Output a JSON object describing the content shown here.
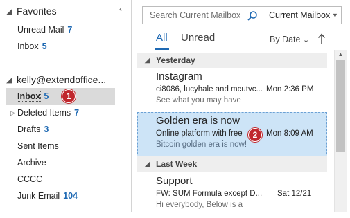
{
  "nav": {
    "favorites_label": "Favorites",
    "favorites": [
      {
        "label": "Unread Mail",
        "count": "7"
      },
      {
        "label": "Inbox",
        "count": "5"
      }
    ],
    "account_label": "kelly@extendoffice...",
    "folders": [
      {
        "label": "Inbox",
        "count": "5"
      },
      {
        "label": "Deleted Items",
        "count": "7"
      },
      {
        "label": "Drafts",
        "count": "3"
      },
      {
        "label": "Sent Items",
        "count": ""
      },
      {
        "label": "Archive",
        "count": ""
      },
      {
        "label": "CCCC",
        "count": ""
      },
      {
        "label": "Junk Email",
        "count": "104"
      }
    ],
    "step1_badge": "1"
  },
  "search": {
    "placeholder": "Search Current Mailbox",
    "scope": "Current Mailbox"
  },
  "tabs": {
    "all": "All",
    "unread": "Unread"
  },
  "sort": {
    "label": "By Date",
    "arrow": "↑"
  },
  "groups": {
    "yesterday": "Yesterday",
    "last_week": "Last Week"
  },
  "messages": [
    {
      "sender": "Instagram",
      "subject": "ci8086, lucyhale and mcutvc...",
      "time": "Mon 2:36 PM",
      "preview": "See what you may have"
    },
    {
      "sender": "Golden era is now",
      "subject": "Online platform with free",
      "time": "Mon 8:09 AM",
      "preview": "Bitcoin golden era is now!"
    },
    {
      "sender": "Support",
      "subject": "FW: SUM Formula except D...",
      "time": "Sat 12/21",
      "preview": "Hi everybody,  Below is a"
    }
  ],
  "step2_badge": "2",
  "colors": {
    "accent": "#1e69b3",
    "selected_bg": "#cde4f7",
    "badge": "#c0272d"
  }
}
